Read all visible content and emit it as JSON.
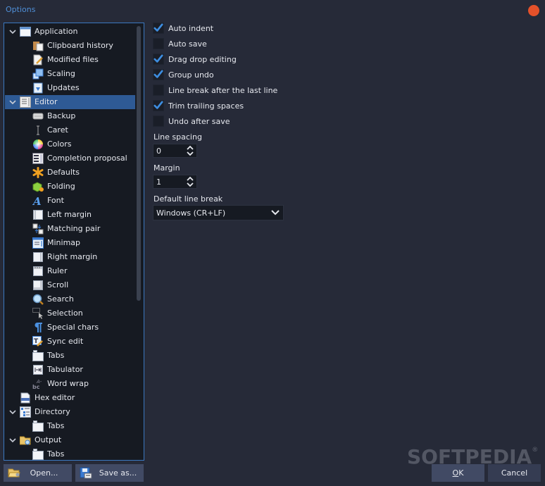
{
  "window": {
    "title": "Options",
    "close_color": "#e4512a"
  },
  "tree": {
    "items": [
      {
        "label": "Application",
        "level": 0,
        "expanded": true,
        "icon": "window-icon"
      },
      {
        "label": "Clipboard history",
        "level": 1,
        "icon": "clipboard-icon"
      },
      {
        "label": "Modified files",
        "level": 1,
        "icon": "document-edit-icon"
      },
      {
        "label": "Scaling",
        "level": 1,
        "icon": "scaling-icon"
      },
      {
        "label": "Updates",
        "level": 1,
        "icon": "updates-icon"
      },
      {
        "label": "Editor",
        "level": 0,
        "expanded": true,
        "selected": true,
        "icon": "editor-icon"
      },
      {
        "label": "Backup",
        "level": 1,
        "icon": "backup-drive-icon"
      },
      {
        "label": "Caret",
        "level": 1,
        "icon": "caret-icon"
      },
      {
        "label": "Colors",
        "level": 1,
        "icon": "color-wheel-icon"
      },
      {
        "label": "Completion proposal",
        "level": 1,
        "icon": "completion-list-icon"
      },
      {
        "label": "Defaults",
        "level": 1,
        "icon": "asterisk-icon"
      },
      {
        "label": "Folding",
        "level": 1,
        "icon": "folding-cube-icon"
      },
      {
        "label": "Font",
        "level": 1,
        "icon": "font-icon"
      },
      {
        "label": "Left margin",
        "level": 1,
        "icon": "left-margin-icon"
      },
      {
        "label": "Matching pair",
        "level": 1,
        "icon": "matching-pair-icon"
      },
      {
        "label": "Minimap",
        "level": 1,
        "icon": "minimap-icon"
      },
      {
        "label": "Right margin",
        "level": 1,
        "icon": "right-margin-icon"
      },
      {
        "label": "Ruler",
        "level": 1,
        "icon": "ruler-icon"
      },
      {
        "label": "Scroll",
        "level": 1,
        "icon": "scroll-icon"
      },
      {
        "label": "Search",
        "level": 1,
        "icon": "magnifier-icon"
      },
      {
        "label": "Selection",
        "level": 1,
        "icon": "selection-icon"
      },
      {
        "label": "Special chars",
        "level": 1,
        "icon": "pilcrow-icon"
      },
      {
        "label": "Sync edit",
        "level": 1,
        "icon": "sync-edit-icon"
      },
      {
        "label": "Tabs",
        "level": 1,
        "icon": "tabs-icon"
      },
      {
        "label": "Tabulator",
        "level": 1,
        "icon": "tabulator-icon"
      },
      {
        "label": "Word wrap",
        "level": 1,
        "icon": "word-wrap-icon"
      },
      {
        "label": "Hex editor",
        "level": 0,
        "icon": "hex-file-icon"
      },
      {
        "label": "Directory",
        "level": 0,
        "expanded": true,
        "icon": "directory-tree-icon"
      },
      {
        "label": "Tabs",
        "level": 1,
        "icon": "tabs-icon"
      },
      {
        "label": "Output",
        "level": 0,
        "expanded": true,
        "icon": "output-folder-icon"
      },
      {
        "label": "Tabs",
        "level": 1,
        "icon": "tabs-icon"
      }
    ]
  },
  "options": {
    "checkboxes": [
      {
        "label": "Auto indent",
        "checked": true
      },
      {
        "label": "Auto save",
        "checked": false
      },
      {
        "label": "Drag drop editing",
        "checked": true
      },
      {
        "label": "Group undo",
        "checked": true
      },
      {
        "label": "Line break after the last line",
        "checked": false
      },
      {
        "label": "Trim trailing spaces",
        "checked": true
      },
      {
        "label": "Undo after save",
        "checked": false
      }
    ],
    "line_spacing": {
      "label": "Line spacing",
      "value": "0"
    },
    "margin": {
      "label": "Margin",
      "value": "1"
    },
    "default_line_break": {
      "label": "Default line break",
      "value": "Windows (CR+LF)"
    }
  },
  "buttons": {
    "open": "Open...",
    "save_as": "Save as...",
    "ok_underline": "O",
    "ok_rest": "K",
    "cancel": "Cancel"
  },
  "watermark": {
    "text": "SOFTPEDIA",
    "mark": "®"
  },
  "colors": {
    "accent": "#3b78c0",
    "selected_row": "#2e5a95",
    "check": "#3d8de0",
    "window_bg": "#262a38",
    "panel_bg": "#161a22"
  }
}
